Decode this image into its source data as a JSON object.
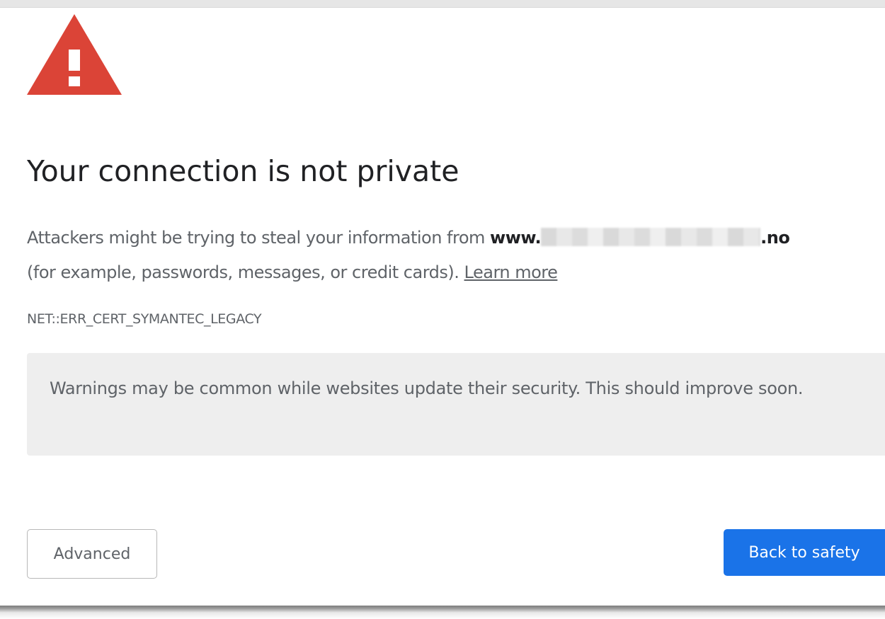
{
  "interstitial": {
    "title": "Your connection is not private",
    "message_prefix": "Attackers might be trying to steal your information from ",
    "domain_start": "www.",
    "domain_end": ".no",
    "message_suffix": "(for example, passwords, messages, or credit cards).",
    "learn_more_label": "Learn more",
    "error_code": "NET::ERR_CERT_SYMANTEC_LEGACY",
    "info_text": "Warnings may be common while websites update their security. This should improve soon.",
    "advanced_label": "Advanced",
    "back_to_safety_label": "Back to safety",
    "icon": "warning-triangle-icon"
  },
  "colors": {
    "warning_red": "#db4437",
    "primary_blue": "#1a73e8",
    "title_text": "#202124",
    "body_text": "#5f6368",
    "info_box_bg": "#eeeeee"
  }
}
